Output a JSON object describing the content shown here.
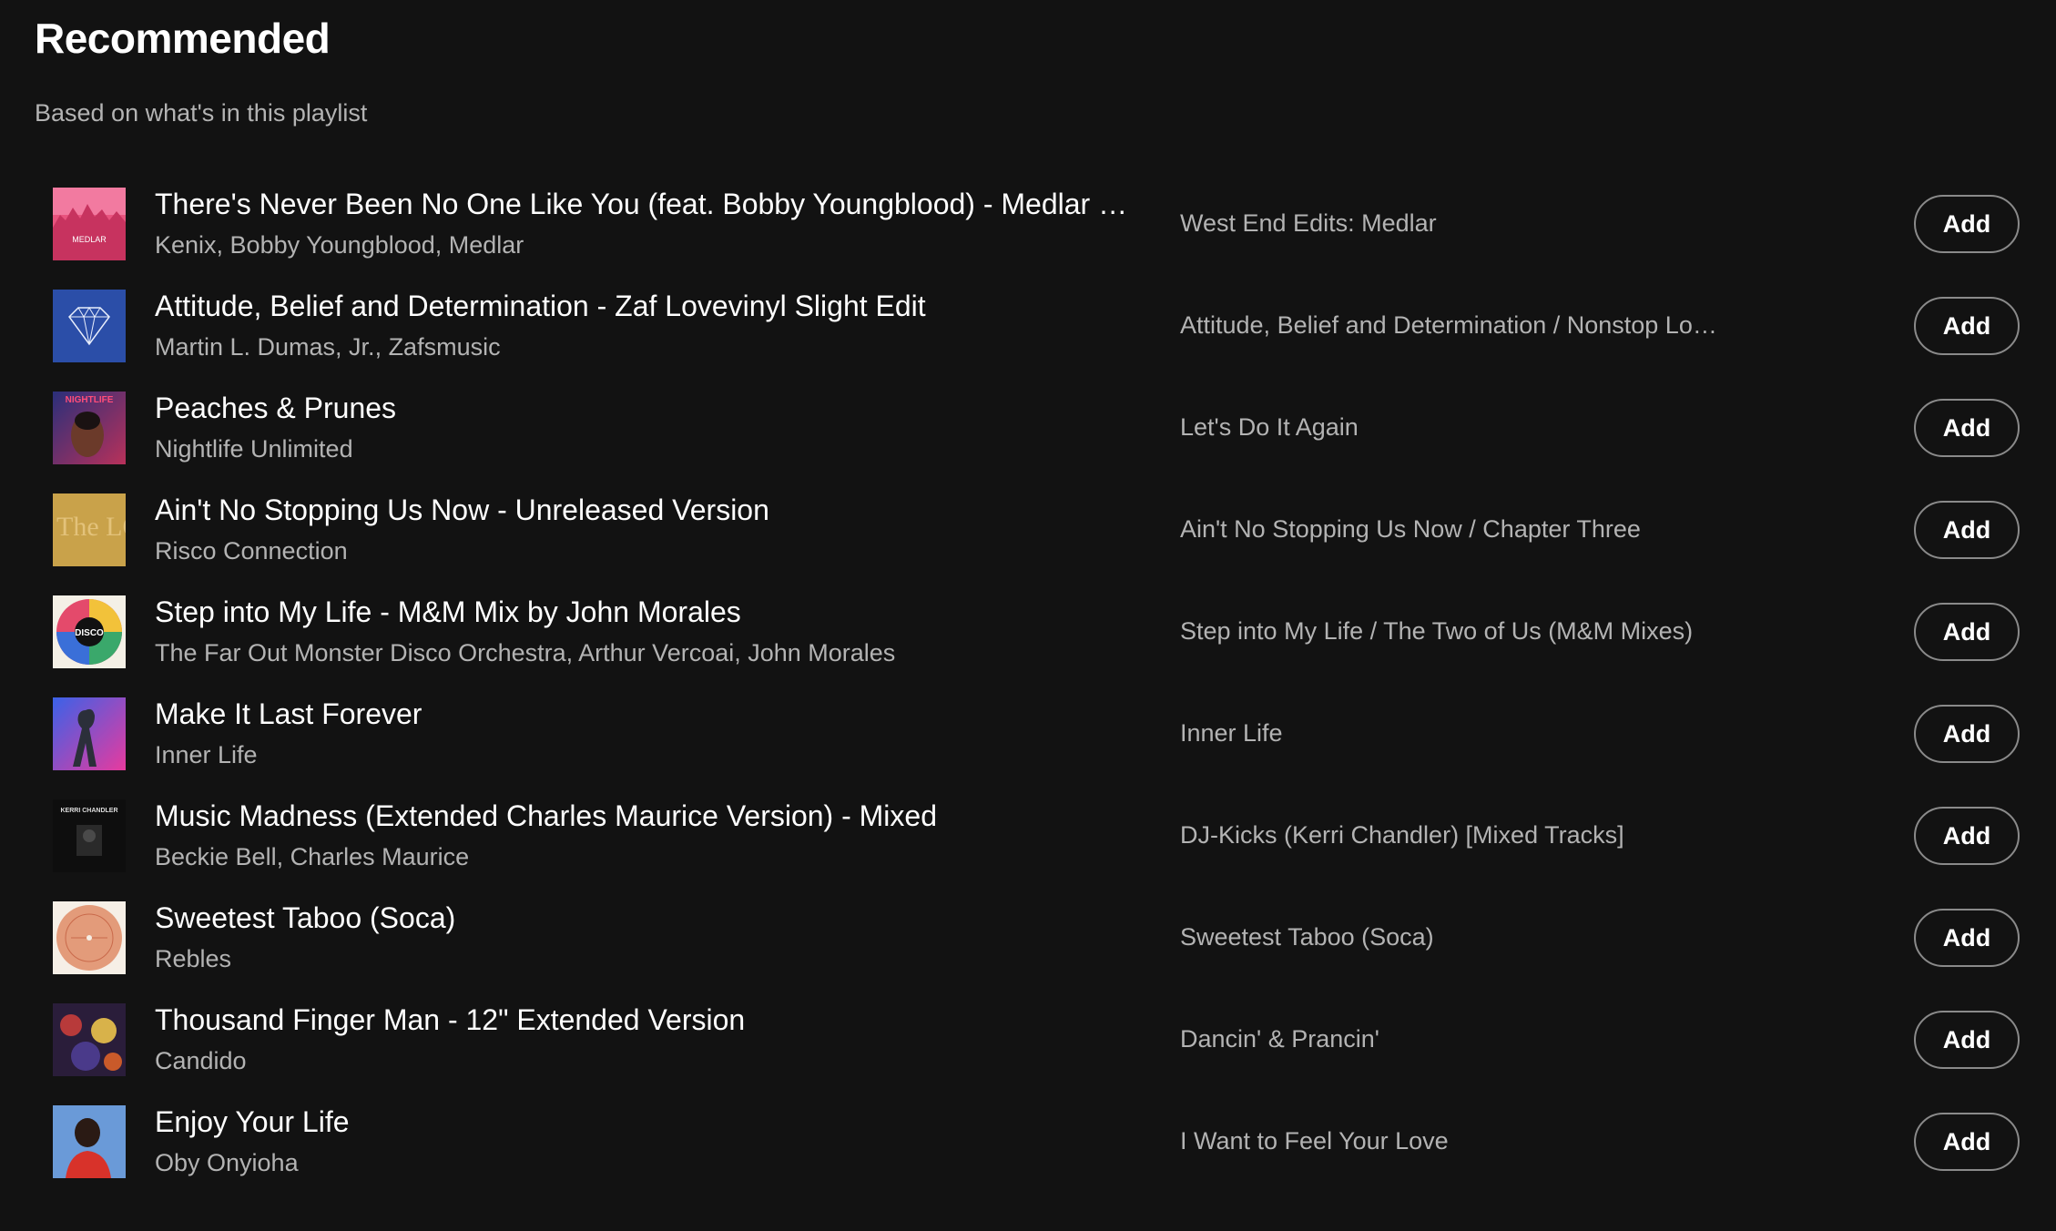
{
  "section": {
    "title": "Recommended",
    "subtitle": "Based on what's in this playlist"
  },
  "tracks": [
    {
      "title": "There's Never Been No One Like You (feat. Bobby Youngblood) - Medlar Edit",
      "artists": "Kenix, Bobby Youngblood, Medlar",
      "album": "West End Edits: Medlar",
      "add_label": "Add",
      "art_text": "MEDLAR"
    },
    {
      "title": "Attitude, Belief and Determination - Zaf Lovevinyl Slight Edit",
      "artists": "Martin L. Dumas, Jr., Zafsmusic",
      "album": "Attitude, Belief and Determination / Nonstop Lovevinyl",
      "add_label": "Add"
    },
    {
      "title": "Peaches & Prunes",
      "artists": "Nightlife Unlimited",
      "album": "Let's Do It Again",
      "add_label": "Add",
      "art_text": "NIGHTLIFE"
    },
    {
      "title": "Ain't No Stopping Us Now - Unreleased Version",
      "artists": "Risco Connection",
      "album": "Ain't No Stopping Us Now / Chapter Three",
      "add_label": "Add",
      "art_text": "The LOFT"
    },
    {
      "title": "Step into My Life - M&M Mix by John Morales",
      "artists": "The Far Out Monster Disco Orchestra, Arthur Vercoai, John Morales",
      "album": "Step into My Life / The Two of Us (M&M Mixes)",
      "add_label": "Add",
      "art_text": "DISCO"
    },
    {
      "title": "Make It Last Forever",
      "artists": "Inner Life",
      "album": "Inner Life",
      "add_label": "Add"
    },
    {
      "title": "Music Madness (Extended Charles Maurice Version) - Mixed",
      "artists": "Beckie Bell, Charles Maurice",
      "album": "DJ-Kicks (Kerri Chandler) [Mixed Tracks]",
      "add_label": "Add",
      "art_text": "KERRI CHANDLER"
    },
    {
      "title": "Sweetest Taboo (Soca)",
      "artists": "Rebles",
      "album": "Sweetest Taboo (Soca)",
      "add_label": "Add"
    },
    {
      "title": "Thousand Finger Man - 12\" Extended Version",
      "artists": "Candido",
      "album": "Dancin' & Prancin'",
      "add_label": "Add"
    },
    {
      "title": "Enjoy Your Life",
      "artists": "Oby Onyioha",
      "album": "I Want to Feel Your Love",
      "add_label": "Add"
    }
  ],
  "colors": {
    "background": "#121212",
    "primary_text": "#ffffff",
    "secondary_text": "#b3b3b3",
    "button_border": "#8a8a8a"
  }
}
